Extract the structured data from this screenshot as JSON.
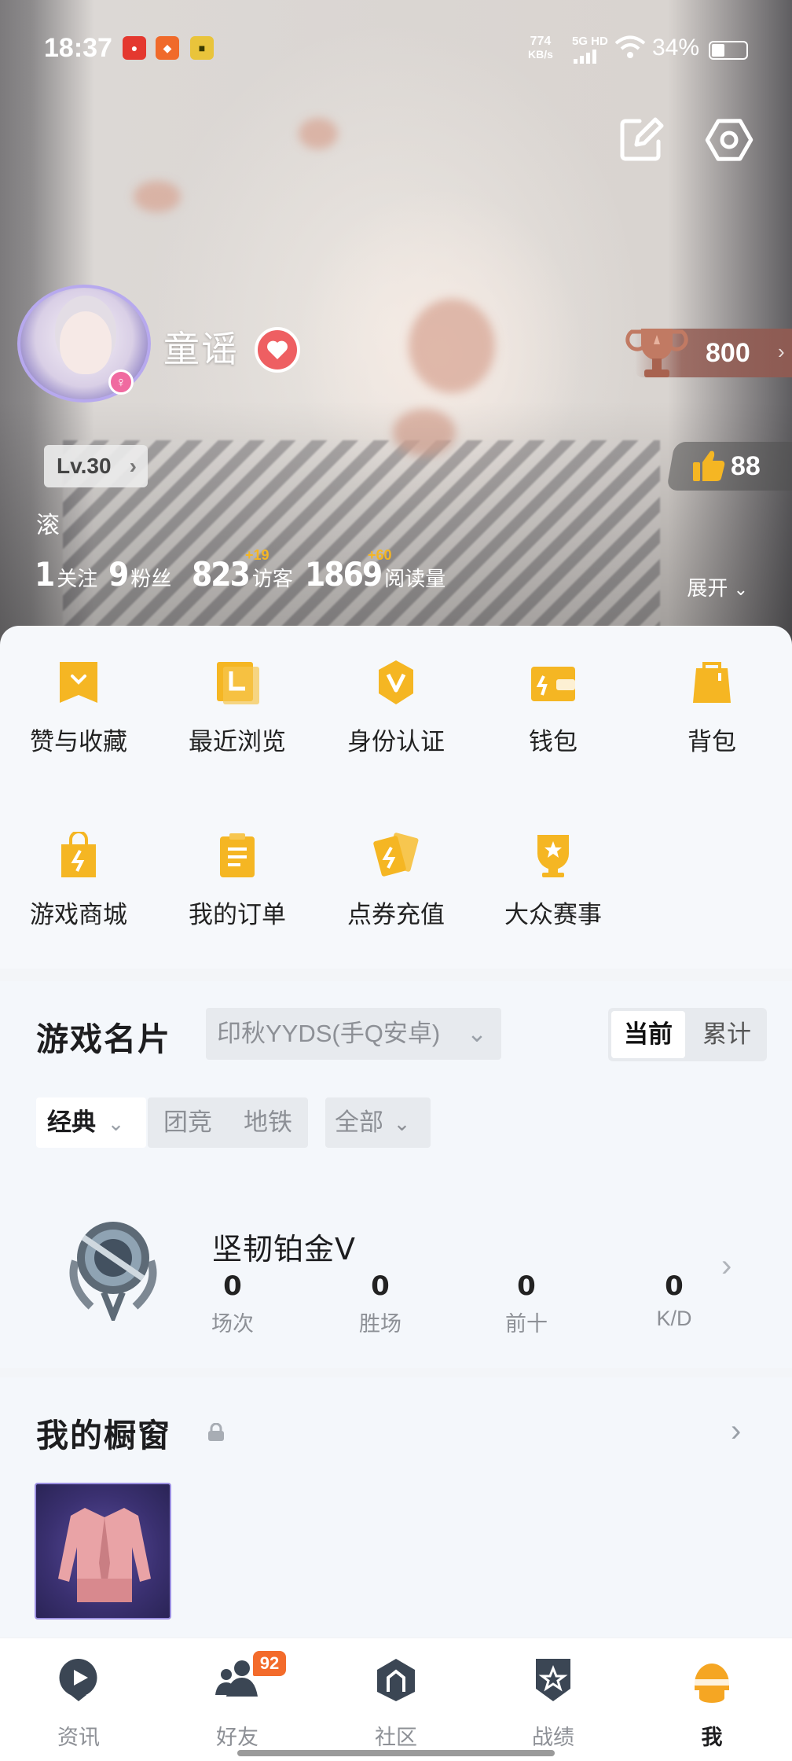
{
  "status_bar": {
    "time": "18:37",
    "net_speed_value": "774",
    "net_speed_unit": "KB/s",
    "network": "5G HD",
    "battery": "34%"
  },
  "profile": {
    "nickname": "童谣",
    "level": "Lv.30",
    "signature": "滚",
    "trophy_points": "800",
    "likes": "88",
    "stats": [
      {
        "value": "1",
        "label": "关注",
        "plus": ""
      },
      {
        "value": "9",
        "label": "粉丝",
        "plus": ""
      },
      {
        "value": "823",
        "label": "访客",
        "plus": "+19"
      },
      {
        "value": "1869",
        "label": "阅读量",
        "plus": "+60"
      }
    ],
    "expand_label": "展开"
  },
  "menu": {
    "items": [
      {
        "label": "赞与收藏",
        "icon": "favorites-icon"
      },
      {
        "label": "最近浏览",
        "icon": "history-icon"
      },
      {
        "label": "身份认证",
        "icon": "verify-icon"
      },
      {
        "label": "钱包",
        "icon": "wallet-icon"
      },
      {
        "label": "背包",
        "icon": "backpack-icon"
      },
      {
        "label": "游戏商城",
        "icon": "shop-icon"
      },
      {
        "label": "我的订单",
        "icon": "orders-icon"
      },
      {
        "label": "点券充值",
        "icon": "coupon-icon"
      },
      {
        "label": "大众赛事",
        "icon": "tournament-icon"
      }
    ]
  },
  "game_card": {
    "title": "游戏名片",
    "server": "印秋YYDS(手Q安卓)",
    "toggle": {
      "current": "当前",
      "cumulative": "累计"
    },
    "mode_selected": "经典",
    "modes_other": [
      "团竞",
      "地铁"
    ],
    "filter": "全部",
    "rank_name": "坚韧铂金Ⅴ",
    "rank_stats": [
      {
        "value": "0",
        "label": "场次"
      },
      {
        "value": "0",
        "label": "胜场"
      },
      {
        "value": "0",
        "label": "前十"
      },
      {
        "value": "0",
        "label": "K/D"
      }
    ]
  },
  "showcase": {
    "title": "我的橱窗"
  },
  "tabbar": {
    "tabs": [
      {
        "label": "资讯",
        "badge": ""
      },
      {
        "label": "好友",
        "badge": "92"
      },
      {
        "label": "社区",
        "badge": ""
      },
      {
        "label": "战绩",
        "badge": ""
      },
      {
        "label": "我",
        "badge": ""
      }
    ]
  },
  "colors": {
    "accent_orange": "#f5b623",
    "badge_orange": "#f36b2b",
    "heart_red": "#ee5f62",
    "page_bg": "#f3f5f8"
  }
}
